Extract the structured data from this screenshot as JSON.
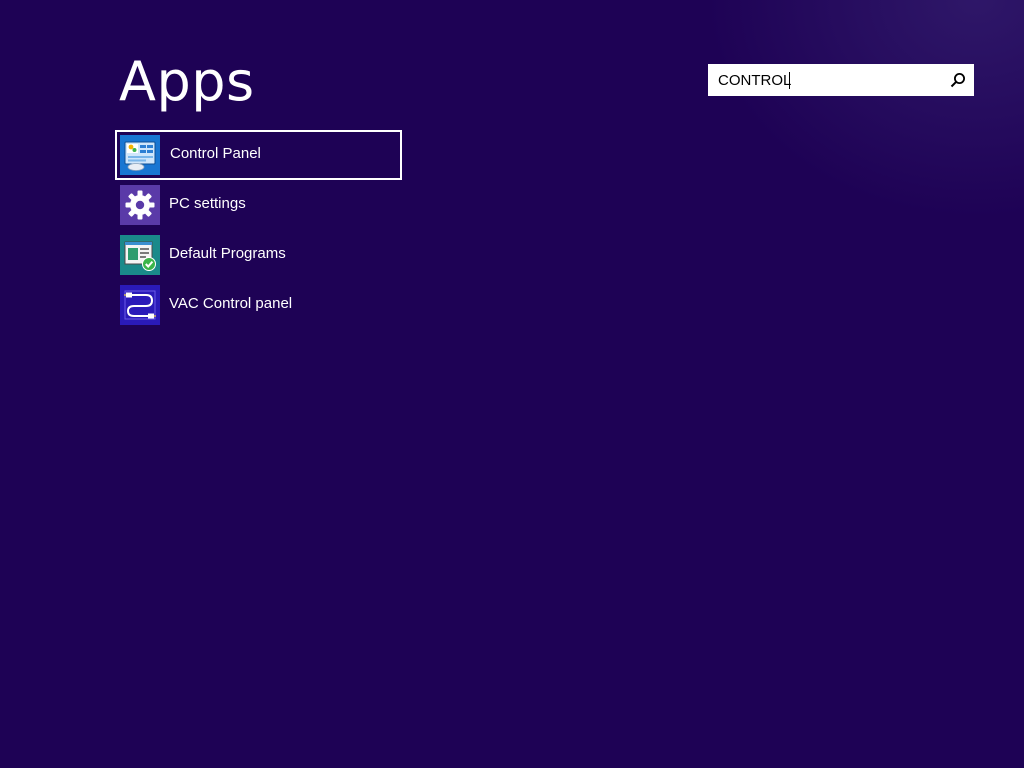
{
  "header": {
    "title": "Apps"
  },
  "search": {
    "value": "CONTROL",
    "icon": "search-icon"
  },
  "results": [
    {
      "label": "Control Panel",
      "icon": "control-panel-icon",
      "tile_color": "#1976d2",
      "selected": true
    },
    {
      "label": "PC settings",
      "icon": "gear-icon",
      "tile_color": "#5a3aa8",
      "selected": false
    },
    {
      "label": "Default Programs",
      "icon": "default-programs-icon",
      "tile_color": "#1a8a8a",
      "selected": false
    },
    {
      "label": "VAC Control panel",
      "icon": "vac-cable-icon",
      "tile_color": "#2a1ab8",
      "selected": false
    }
  ],
  "colors": {
    "background": "#1e0255",
    "text": "#ffffff",
    "search_bg": "#ffffff"
  }
}
